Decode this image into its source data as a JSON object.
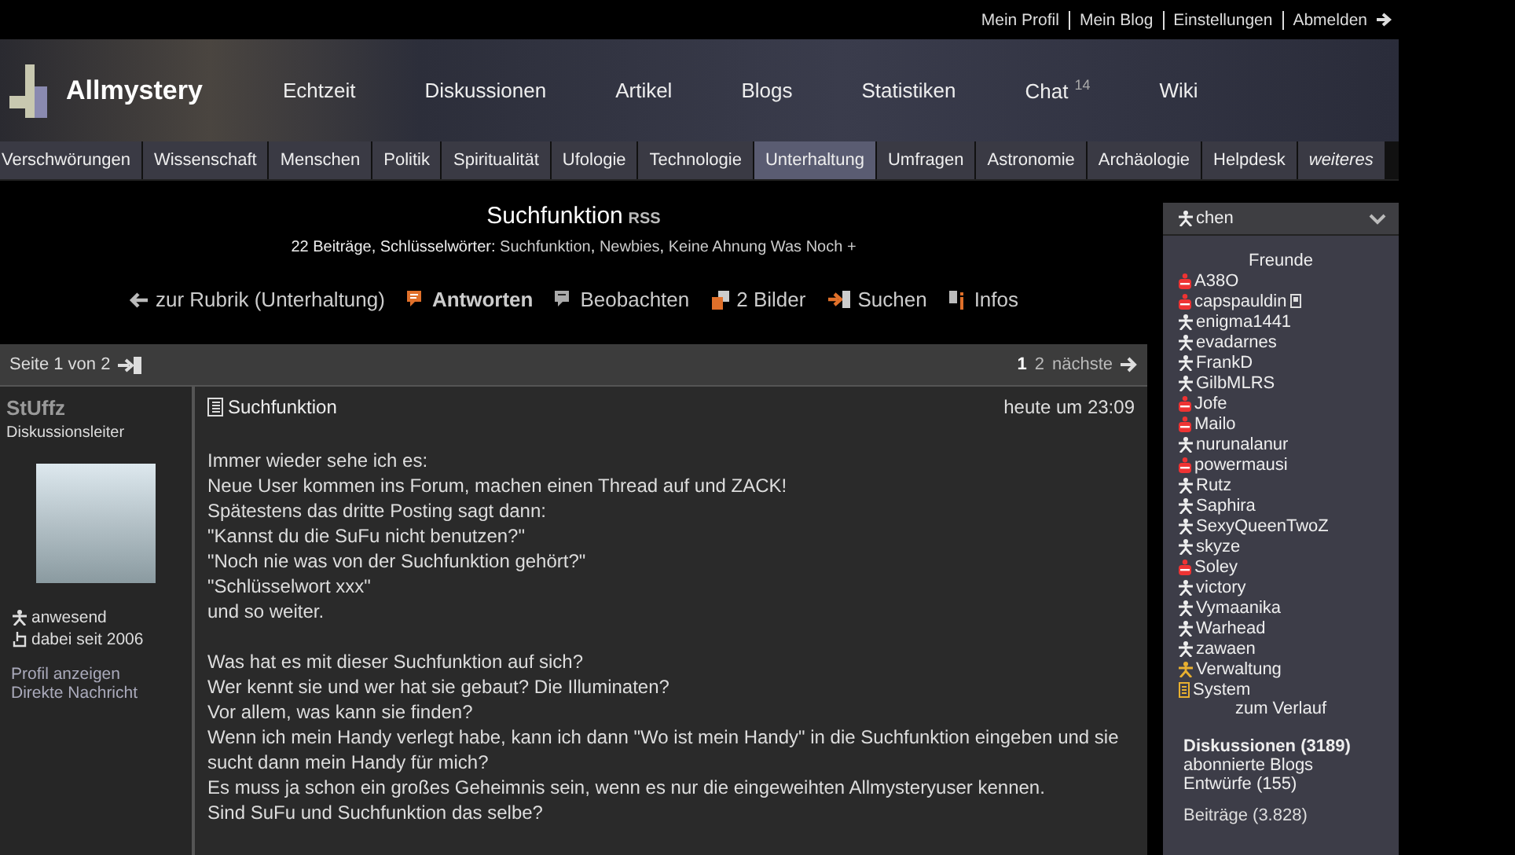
{
  "top_links": [
    "Mein Profil",
    "Mein Blog",
    "Einstellungen",
    "Abmelden"
  ],
  "logo": "Allmystery",
  "main_nav": [
    {
      "label": "Echtzeit"
    },
    {
      "label": "Diskussionen"
    },
    {
      "label": "Artikel"
    },
    {
      "label": "Blogs"
    },
    {
      "label": "Statistiken"
    },
    {
      "label": "Chat",
      "badge": "14"
    },
    {
      "label": "Wiki"
    }
  ],
  "categories": [
    {
      "label": "Verschwörungen",
      "selected": false
    },
    {
      "label": "Wissenschaft",
      "selected": false
    },
    {
      "label": "Menschen",
      "selected": false
    },
    {
      "label": "Politik",
      "selected": false
    },
    {
      "label": "Spiritualität",
      "selected": false
    },
    {
      "label": "Ufologie",
      "selected": false
    },
    {
      "label": "Technologie",
      "selected": false
    },
    {
      "label": "Unterhaltung",
      "selected": true
    },
    {
      "label": "Umfragen",
      "selected": false
    },
    {
      "label": "Astronomie",
      "selected": false
    },
    {
      "label": "Archäologie",
      "selected": false
    },
    {
      "label": "Helpdesk",
      "selected": false
    },
    {
      "label": "weiteres",
      "selected": false
    }
  ],
  "thread": {
    "title": "Suchfunktion",
    "rss": "RSS",
    "meta": "22 Beiträge, Schlüsselwörter:",
    "keywords": [
      "Suchfunktion",
      "Newbies",
      "Keine Ahnung Was Noch"
    ],
    "separator": ",",
    "keyword_more": "+"
  },
  "actions": [
    {
      "kind": "back",
      "label": "zur Rubrik (Unterhaltung)"
    },
    {
      "kind": "reply",
      "label": "Antworten"
    },
    {
      "kind": "watch",
      "label": "Beobachten"
    },
    {
      "kind": "images",
      "label": "2 Bilder"
    },
    {
      "kind": "search",
      "label": "Suchen"
    },
    {
      "kind": "info",
      "label": "Infos"
    }
  ],
  "pagination": {
    "label": "Seite 1 von 2",
    "pages": [
      {
        "label": "1",
        "selected": true
      },
      {
        "label": "2",
        "selected": false
      }
    ],
    "next": "nächste"
  },
  "post": {
    "author": "StUffz",
    "role": "Diskussionsleiter",
    "status": "anwesend",
    "since": "dabei seit 2006",
    "links": [
      "Profil anzeigen",
      "Direkte Nachricht"
    ],
    "title": "Suchfunktion",
    "time": "heute um 23:09",
    "paragraphs": [
      [
        "Immer wieder sehe ich es:",
        "Neue User kommen ins Forum, machen einen Thread auf und ZACK!",
        "Spätestens das dritte Posting sagt dann:",
        "\"Kannst du die SuFu nicht benutzen?\"",
        "\"Noch nie was von der Suchfunktion gehört?\"",
        "\"Schlüsselwort xxx\"",
        "und so weiter."
      ],
      [
        "Was hat es mit dieser Suchfunktion auf sich?",
        "Wer kennt sie und wer hat sie gebaut? Die Illuminaten?",
        "Vor allem, was kann sie finden?",
        "Wenn ich mein Handy verlegt habe, kann ich dann \"Wo ist mein Handy\" in die Suchfunktion eingeben und sie sucht dann mein Handy für mich?",
        "Es muss ja schon ein großes Geheimnis sein, wenn es nur die eingeweihten Allmysteryuser kennen.",
        "Sind SuFu und Suchfunktion das selbe?"
      ]
    ]
  },
  "sidebar": {
    "header": "chen",
    "friends_title": "Freunde",
    "friends": [
      {
        "name": "A38O",
        "kind": "busy"
      },
      {
        "name": "capspauldin",
        "kind": "busy",
        "mobile": true
      },
      {
        "name": "enigma1441",
        "kind": "online"
      },
      {
        "name": "evadarnes",
        "kind": "online"
      },
      {
        "name": "FrankD",
        "kind": "online"
      },
      {
        "name": "GilbMLRS",
        "kind": "online"
      },
      {
        "name": "Jofe",
        "kind": "busy"
      },
      {
        "name": "Mailo",
        "kind": "busy"
      },
      {
        "name": "nurunalanur",
        "kind": "online"
      },
      {
        "name": "powermausi",
        "kind": "busy"
      },
      {
        "name": "Rutz",
        "kind": "online"
      },
      {
        "name": "Saphira",
        "kind": "online"
      },
      {
        "name": "SexyQueenTwoZ",
        "kind": "online"
      },
      {
        "name": "skyze",
        "kind": "online"
      },
      {
        "name": "Soley",
        "kind": "busy"
      },
      {
        "name": "victory",
        "kind": "online"
      },
      {
        "name": "Vymaanika",
        "kind": "online"
      },
      {
        "name": "Warhead",
        "kind": "online"
      },
      {
        "name": "zawaen",
        "kind": "online"
      },
      {
        "name": "Verwaltung",
        "kind": "admin"
      },
      {
        "name": "System",
        "kind": "system"
      }
    ],
    "history_link": "zum Verlauf",
    "links": [
      {
        "label": "Diskussionen (3189)",
        "bold": true
      },
      {
        "label": "abonnierte Blogs",
        "bold": false
      },
      {
        "label": "Entwürfe (155)",
        "bold": false
      }
    ],
    "posts": "Beiträge (3.828)"
  }
}
